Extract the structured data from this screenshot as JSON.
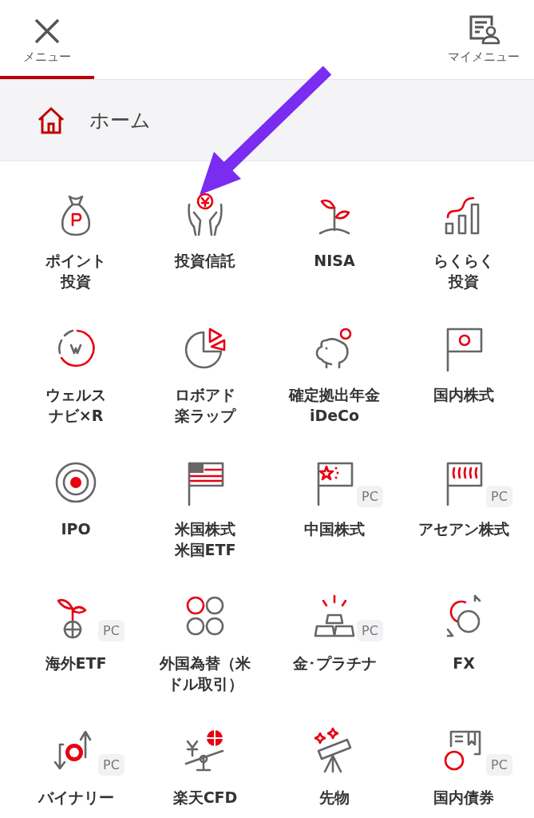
{
  "header": {
    "tabs": [
      {
        "label": "メニュー",
        "selected": true
      },
      {
        "label": "マイメニュー",
        "selected": false
      }
    ]
  },
  "home": {
    "label": "ホーム"
  },
  "menu_items": [
    {
      "lines": [
        "ポイント",
        "投資"
      ]
    },
    {
      "lines": [
        "投資信託"
      ]
    },
    {
      "lines": [
        "NISA"
      ]
    },
    {
      "lines": [
        "らくらく",
        "投資"
      ]
    },
    {
      "lines": [
        "ウェルス",
        "ナビ×R"
      ]
    },
    {
      "lines": [
        "ロボアド",
        "楽ラップ"
      ]
    },
    {
      "lines": [
        "確定拠出年金",
        "iDeCo"
      ]
    },
    {
      "lines": [
        "国内株式"
      ]
    },
    {
      "lines": [
        "IPO"
      ]
    },
    {
      "lines": [
        "米国株式",
        "米国ETF"
      ]
    },
    {
      "lines": [
        "中国株式"
      ],
      "badge": "PC"
    },
    {
      "lines": [
        "アセアン株式"
      ],
      "badge": "PC"
    },
    {
      "lines": [
        "海外ETF"
      ],
      "badge": "PC"
    },
    {
      "lines": [
        "外国為替（米",
        "ドル取引）"
      ]
    },
    {
      "lines": [
        "金･プラチナ"
      ],
      "badge": "PC"
    },
    {
      "lines": [
        "FX"
      ]
    },
    {
      "lines": [
        "バイナリー"
      ],
      "badge": "PC"
    },
    {
      "lines": [
        "楽天CFD"
      ]
    },
    {
      "lines": [
        "先物"
      ]
    },
    {
      "lines": [
        "国内債券"
      ],
      "badge": "PC"
    }
  ]
}
